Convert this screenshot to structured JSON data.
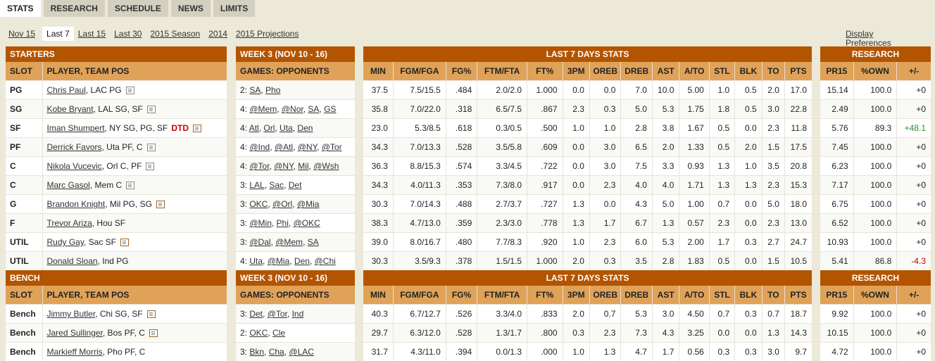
{
  "tabs": [
    "STATS",
    "RESEARCH",
    "SCHEDULE",
    "NEWS",
    "LIMITS"
  ],
  "active_tab": "STATS",
  "ranges": [
    "Nov 15",
    "Last 7",
    "Last 15",
    "Last 30",
    "2015 Season",
    "2014",
    "2015 Projections"
  ],
  "active_range": "Last 7",
  "display_preferences": "Display Preferences",
  "sections": {
    "starters": "STARTERS",
    "bench": "BENCH",
    "week": "WEEK 3 (NOV 10 - 16)",
    "stats": "LAST 7 DAYS STATS",
    "research": "RESEARCH"
  },
  "columns": {
    "slot": "SLOT",
    "player": "PLAYER, TEAM POS",
    "games": "GAMES: OPPONENTS",
    "stats": [
      "MIN",
      "FGM/FGA",
      "FG%",
      "FTM/FTA",
      "FT%",
      "3PM",
      "OREB",
      "DREB",
      "AST",
      "A/TO",
      "STL",
      "BLK",
      "TO",
      "PTS"
    ],
    "research": [
      "PR15",
      "%OWN",
      "+/-"
    ]
  },
  "starters": [
    {
      "slot": "PG",
      "name": "Chris Paul",
      "team": ", LAC PG",
      "status": "",
      "note": "plain",
      "games": "2: ",
      "opps": [
        "SA",
        "Pho"
      ],
      "stats": [
        "37.5",
        "7.5/15.5",
        ".484",
        "2.0/2.0",
        "1.000",
        "0.0",
        "0.0",
        "7.0",
        "10.0",
        "5.00",
        "1.0",
        "0.5",
        "2.0",
        "17.0"
      ],
      "research": [
        "15.14",
        "100.0",
        "+0"
      ]
    },
    {
      "slot": "SG",
      "name": "Kobe Bryant",
      "team": ", LAL SG, SF",
      "status": "",
      "note": "plain",
      "games": "4: ",
      "opps": [
        "@Mem",
        "@Nor",
        "SA",
        "GS"
      ],
      "stats": [
        "35.8",
        "7.0/22.0",
        ".318",
        "6.5/7.5",
        ".867",
        "2.3",
        "0.3",
        "5.0",
        "5.3",
        "1.75",
        "1.8",
        "0.5",
        "3.0",
        "22.8"
      ],
      "research": [
        "2.49",
        "100.0",
        "+0"
      ]
    },
    {
      "slot": "SF",
      "name": "Iman Shumpert",
      "team": ", NY SG, PG, SF",
      "status": "DTD",
      "note": "alt",
      "games": "4: ",
      "opps": [
        "Atl",
        "Orl",
        "Uta",
        "Den"
      ],
      "stats": [
        "23.0",
        "5.3/8.5",
        ".618",
        "0.3/0.5",
        ".500",
        "1.0",
        "1.0",
        "2.8",
        "3.8",
        "1.67",
        "0.5",
        "0.0",
        "2.3",
        "11.8"
      ],
      "research": [
        "5.76",
        "89.3",
        "+48.1"
      ]
    },
    {
      "slot": "PF",
      "name": "Derrick Favors",
      "team": ", Uta PF, C",
      "status": "",
      "note": "plain",
      "games": "4: ",
      "opps": [
        "@Ind",
        "@Atl",
        "@NY",
        "@Tor"
      ],
      "stats": [
        "34.3",
        "7.0/13.3",
        ".528",
        "3.5/5.8",
        ".609",
        "0.0",
        "3.0",
        "6.5",
        "2.0",
        "1.33",
        "0.5",
        "2.0",
        "1.5",
        "17.5"
      ],
      "research": [
        "7.45",
        "100.0",
        "+0"
      ]
    },
    {
      "slot": "C",
      "name": "Nikola Vucevic",
      "team": ", Orl C, PF",
      "status": "",
      "note": "plain",
      "games": "4: ",
      "opps": [
        "@Tor",
        "@NY",
        "Mil",
        "@Wsh"
      ],
      "stats": [
        "36.3",
        "8.8/15.3",
        ".574",
        "3.3/4.5",
        ".722",
        "0.0",
        "3.0",
        "7.5",
        "3.3",
        "0.93",
        "1.3",
        "1.0",
        "3.5",
        "20.8"
      ],
      "research": [
        "6.23",
        "100.0",
        "+0"
      ]
    },
    {
      "slot": "C",
      "name": "Marc Gasol",
      "team": ", Mem C",
      "status": "",
      "note": "plain",
      "games": "3: ",
      "opps": [
        "LAL",
        "Sac",
        "Det"
      ],
      "stats": [
        "34.3",
        "4.0/11.3",
        ".353",
        "7.3/8.0",
        ".917",
        "0.0",
        "2.3",
        "4.0",
        "4.0",
        "1.71",
        "1.3",
        "1.3",
        "2.3",
        "15.3"
      ],
      "research": [
        "7.17",
        "100.0",
        "+0"
      ]
    },
    {
      "slot": "G",
      "name": "Brandon Knight",
      "team": ", Mil PG, SG",
      "status": "",
      "note": "alt",
      "games": "3: ",
      "opps": [
        "OKC",
        "@Orl",
        "@Mia"
      ],
      "stats": [
        "30.3",
        "7.0/14.3",
        ".488",
        "2.7/3.7",
        ".727",
        "1.3",
        "0.0",
        "4.3",
        "5.0",
        "1.00",
        "0.7",
        "0.0",
        "5.0",
        "18.0"
      ],
      "research": [
        "6.75",
        "100.0",
        "+0"
      ]
    },
    {
      "slot": "F",
      "name": "Trevor Ariza",
      "team": ", Hou SF",
      "status": "",
      "note": "none",
      "games": "3: ",
      "opps": [
        "@Min",
        "Phi",
        "@OKC"
      ],
      "stats": [
        "38.3",
        "4.7/13.0",
        ".359",
        "2.3/3.0",
        ".778",
        "1.3",
        "1.7",
        "6.7",
        "1.3",
        "0.57",
        "2.3",
        "0.0",
        "2.3",
        "13.0"
      ],
      "research": [
        "6.52",
        "100.0",
        "+0"
      ]
    },
    {
      "slot": "UTIL",
      "name": "Rudy Gay",
      "team": ", Sac SF",
      "status": "",
      "note": "alt",
      "games": "3: ",
      "opps": [
        "@Dal",
        "@Mem",
        "SA"
      ],
      "stats": [
        "39.0",
        "8.0/16.7",
        ".480",
        "7.7/8.3",
        ".920",
        "1.0",
        "2.3",
        "6.0",
        "5.3",
        "2.00",
        "1.7",
        "0.3",
        "2.7",
        "24.7"
      ],
      "research": [
        "10.93",
        "100.0",
        "+0"
      ]
    },
    {
      "slot": "UTIL",
      "name": "Donald Sloan",
      "team": ", Ind PG",
      "status": "",
      "note": "none",
      "games": "4: ",
      "opps": [
        "Uta",
        "@Mia",
        "Den",
        "@Chi"
      ],
      "stats": [
        "30.3",
        "3.5/9.3",
        ".378",
        "1.5/1.5",
        "1.000",
        "2.0",
        "0.3",
        "3.5",
        "2.8",
        "1.83",
        "0.5",
        "0.0",
        "1.5",
        "10.5"
      ],
      "research": [
        "5.41",
        "86.8",
        "-4.3"
      ]
    }
  ],
  "bench": [
    {
      "slot": "Bench",
      "name": "Jimmy Butler",
      "team": ", Chi SG, SF",
      "status": "",
      "note": "alt",
      "games": "3: ",
      "opps": [
        "Det",
        "@Tor",
        "Ind"
      ],
      "stats": [
        "40.3",
        "6.7/12.7",
        ".526",
        "3.3/4.0",
        ".833",
        "2.0",
        "0.7",
        "5.3",
        "3.0",
        "4.50",
        "0.7",
        "0.3",
        "0.7",
        "18.7"
      ],
      "research": [
        "9.92",
        "100.0",
        "+0"
      ]
    },
    {
      "slot": "Bench",
      "name": "Jared Sullinger",
      "team": ", Bos PF, C",
      "status": "",
      "note": "alt",
      "games": "2: ",
      "opps": [
        "OKC",
        "Cle"
      ],
      "stats": [
        "29.7",
        "6.3/12.0",
        ".528",
        "1.3/1.7",
        ".800",
        "0.3",
        "2.3",
        "7.3",
        "4.3",
        "3.25",
        "0.0",
        "0.0",
        "1.3",
        "14.3"
      ],
      "research": [
        "10.15",
        "100.0",
        "+0"
      ]
    },
    {
      "slot": "Bench",
      "name": "Markieff Morris",
      "team": ", Pho PF, C",
      "status": "",
      "note": "none",
      "games": "3: ",
      "opps": [
        "Bkn",
        "Cha",
        "@LAC"
      ],
      "stats": [
        "31.7",
        "4.3/11.0",
        ".394",
        "0.0/1.3",
        ".000",
        "1.0",
        "1.3",
        "4.7",
        "1.7",
        "0.56",
        "0.3",
        "0.3",
        "3.0",
        "9.7"
      ],
      "research": [
        "4.72",
        "100.0",
        "+0"
      ]
    }
  ]
}
